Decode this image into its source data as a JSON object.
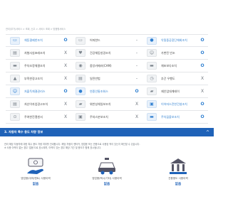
{
  "breadcrumb": "관리(부가)서비스  >  조회, 신고  >  서비스 조회  >  맞춤형서비스",
  "services": [
    [
      {
        "label": "체동결제한조치",
        "status": "O",
        "on": true,
        "icon": "id-card-icon"
      },
      {
        "label": "어떠한드",
        "status": "-",
        "on": false,
        "icon": "card-icon"
      },
      {
        "label": "악질중공장단체회조치",
        "status": "O",
        "on": true,
        "icon": "user-icon"
      }
    ],
    [
      {
        "label": "처형사실초래조치",
        "status": "X",
        "on": false,
        "icon": "document-icon"
      },
      {
        "label": "건강체동방경조치",
        "status": "-",
        "on": false,
        "icon": "heart-icon"
      },
      {
        "label": "가변된 빈조",
        "status": "O",
        "on": true,
        "icon": "person-icon"
      }
    ],
    [
      {
        "label": "주차조정체결조치",
        "status": "X",
        "on": false,
        "icon": "car-icon"
      },
      {
        "label": "중앙카메라(CAM)",
        "status": "-",
        "on": false,
        "icon": "camera-icon"
      },
      {
        "label": "체포보다조치",
        "status": "O",
        "on": true,
        "icon": "car-icon"
      }
    ],
    [
      {
        "label": "부족한경고조치",
        "status": "X",
        "on": false,
        "icon": "warning-icon"
      },
      {
        "label": "일된반법",
        "status": "-",
        "on": false,
        "icon": "document-icon"
      },
      {
        "label": "추간 우행도",
        "status": "X",
        "on": false,
        "icon": "clock-icon"
      }
    ],
    [
      {
        "label": "처출득체결권리스",
        "status": "O",
        "on": true,
        "icon": "person-icon"
      },
      {
        "label": "연중인통조회스",
        "status": "O",
        "on": true,
        "icon": "user-icon"
      },
      {
        "label": "재인업대계레이",
        "status": "X",
        "on": false,
        "icon": "truck-icon"
      }
    ],
    [
      {
        "label": "처산이자업경고조치",
        "status": "X",
        "on": false,
        "icon": "document-icon"
      },
      {
        "label": "위반성체일보조치",
        "status": "X",
        "on": false,
        "icon": "truck-icon"
      },
      {
        "label": "이어머스전한건설조치",
        "status": "O",
        "on": true,
        "icon": "monitor-icon"
      }
    ],
    [
      {
        "label": "주여한진맹센서",
        "status": "X",
        "on": false,
        "icon": "bicycle-icon"
      },
      {
        "label": "주처스분보조치",
        "status": "X",
        "on": false,
        "icon": "monitor-icon"
      },
      {
        "label": "주차꿈을보조치",
        "status": "O",
        "on": true,
        "icon": "car-icon"
      }
    ]
  ],
  "section": {
    "title": "3. 자동차 특수 용도 차량 정보",
    "toggle": "^"
  },
  "description": [
    "관리 해당 자동차에 대한 특수 용도 차량 여부를 안내합니다. 해당 차량이 렌터카, 영업용 또는 관용으로 사용된 적이 있는지 확인할 수 있습니다.",
    "※ 사용 이력이 없는 경우 '없음'으로 표시되며, 이력이 있는 경우 해당 기간 및 용도가 함께 표시됩니다."
  ],
  "summary": [
    {
      "label": "영업용(대여/렌트) 사용이력",
      "value": "없음",
      "icon": "rental-icon"
    },
    {
      "label": "영업용(택시/기타) 사용이력",
      "value": "없음",
      "icon": "taxi-icon"
    },
    {
      "label": "관용용도 사용이력",
      "value": "없음",
      "icon": "government-icon"
    }
  ],
  "colors": {
    "accent": "#1f62b8",
    "on": "#2f7fd0",
    "off": "#6f777f"
  }
}
